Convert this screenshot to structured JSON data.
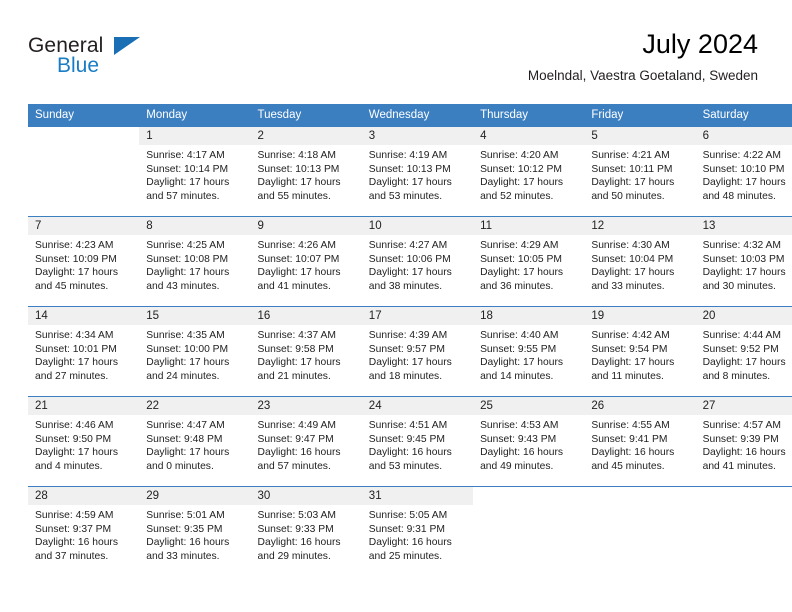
{
  "brand": {
    "name_part1": "General",
    "name_part2": "Blue",
    "triangle_color": "#1a6fb4",
    "blue_color": "#1a7dc4"
  },
  "header": {
    "title": "July 2024",
    "subtitle": "Moelndal, Vaestra Goetaland, Sweden"
  },
  "theme": {
    "header_bg": "#3c7fc1",
    "daynum_bg": "#f0f0f0",
    "text": "#222222"
  },
  "calendar": {
    "weekday_headers": [
      "Sunday",
      "Monday",
      "Tuesday",
      "Wednesday",
      "Thursday",
      "Friday",
      "Saturday"
    ],
    "weeks": [
      [
        {
          "day": "",
          "sunrise": "",
          "sunset": "",
          "daylight_line1": "",
          "daylight_line2": ""
        },
        {
          "day": "1",
          "sunrise": "Sunrise: 4:17 AM",
          "sunset": "Sunset: 10:14 PM",
          "daylight_line1": "Daylight: 17 hours",
          "daylight_line2": "and 57 minutes."
        },
        {
          "day": "2",
          "sunrise": "Sunrise: 4:18 AM",
          "sunset": "Sunset: 10:13 PM",
          "daylight_line1": "Daylight: 17 hours",
          "daylight_line2": "and 55 minutes."
        },
        {
          "day": "3",
          "sunrise": "Sunrise: 4:19 AM",
          "sunset": "Sunset: 10:13 PM",
          "daylight_line1": "Daylight: 17 hours",
          "daylight_line2": "and 53 minutes."
        },
        {
          "day": "4",
          "sunrise": "Sunrise: 4:20 AM",
          "sunset": "Sunset: 10:12 PM",
          "daylight_line1": "Daylight: 17 hours",
          "daylight_line2": "and 52 minutes."
        },
        {
          "day": "5",
          "sunrise": "Sunrise: 4:21 AM",
          "sunset": "Sunset: 10:11 PM",
          "daylight_line1": "Daylight: 17 hours",
          "daylight_line2": "and 50 minutes."
        },
        {
          "day": "6",
          "sunrise": "Sunrise: 4:22 AM",
          "sunset": "Sunset: 10:10 PM",
          "daylight_line1": "Daylight: 17 hours",
          "daylight_line2": "and 48 minutes."
        }
      ],
      [
        {
          "day": "7",
          "sunrise": "Sunrise: 4:23 AM",
          "sunset": "Sunset: 10:09 PM",
          "daylight_line1": "Daylight: 17 hours",
          "daylight_line2": "and 45 minutes."
        },
        {
          "day": "8",
          "sunrise": "Sunrise: 4:25 AM",
          "sunset": "Sunset: 10:08 PM",
          "daylight_line1": "Daylight: 17 hours",
          "daylight_line2": "and 43 minutes."
        },
        {
          "day": "9",
          "sunrise": "Sunrise: 4:26 AM",
          "sunset": "Sunset: 10:07 PM",
          "daylight_line1": "Daylight: 17 hours",
          "daylight_line2": "and 41 minutes."
        },
        {
          "day": "10",
          "sunrise": "Sunrise: 4:27 AM",
          "sunset": "Sunset: 10:06 PM",
          "daylight_line1": "Daylight: 17 hours",
          "daylight_line2": "and 38 minutes."
        },
        {
          "day": "11",
          "sunrise": "Sunrise: 4:29 AM",
          "sunset": "Sunset: 10:05 PM",
          "daylight_line1": "Daylight: 17 hours",
          "daylight_line2": "and 36 minutes."
        },
        {
          "day": "12",
          "sunrise": "Sunrise: 4:30 AM",
          "sunset": "Sunset: 10:04 PM",
          "daylight_line1": "Daylight: 17 hours",
          "daylight_line2": "and 33 minutes."
        },
        {
          "day": "13",
          "sunrise": "Sunrise: 4:32 AM",
          "sunset": "Sunset: 10:03 PM",
          "daylight_line1": "Daylight: 17 hours",
          "daylight_line2": "and 30 minutes."
        }
      ],
      [
        {
          "day": "14",
          "sunrise": "Sunrise: 4:34 AM",
          "sunset": "Sunset: 10:01 PM",
          "daylight_line1": "Daylight: 17 hours",
          "daylight_line2": "and 27 minutes."
        },
        {
          "day": "15",
          "sunrise": "Sunrise: 4:35 AM",
          "sunset": "Sunset: 10:00 PM",
          "daylight_line1": "Daylight: 17 hours",
          "daylight_line2": "and 24 minutes."
        },
        {
          "day": "16",
          "sunrise": "Sunrise: 4:37 AM",
          "sunset": "Sunset: 9:58 PM",
          "daylight_line1": "Daylight: 17 hours",
          "daylight_line2": "and 21 minutes."
        },
        {
          "day": "17",
          "sunrise": "Sunrise: 4:39 AM",
          "sunset": "Sunset: 9:57 PM",
          "daylight_line1": "Daylight: 17 hours",
          "daylight_line2": "and 18 minutes."
        },
        {
          "day": "18",
          "sunrise": "Sunrise: 4:40 AM",
          "sunset": "Sunset: 9:55 PM",
          "daylight_line1": "Daylight: 17 hours",
          "daylight_line2": "and 14 minutes."
        },
        {
          "day": "19",
          "sunrise": "Sunrise: 4:42 AM",
          "sunset": "Sunset: 9:54 PM",
          "daylight_line1": "Daylight: 17 hours",
          "daylight_line2": "and 11 minutes."
        },
        {
          "day": "20",
          "sunrise": "Sunrise: 4:44 AM",
          "sunset": "Sunset: 9:52 PM",
          "daylight_line1": "Daylight: 17 hours",
          "daylight_line2": "and 8 minutes."
        }
      ],
      [
        {
          "day": "21",
          "sunrise": "Sunrise: 4:46 AM",
          "sunset": "Sunset: 9:50 PM",
          "daylight_line1": "Daylight: 17 hours",
          "daylight_line2": "and 4 minutes."
        },
        {
          "day": "22",
          "sunrise": "Sunrise: 4:47 AM",
          "sunset": "Sunset: 9:48 PM",
          "daylight_line1": "Daylight: 17 hours",
          "daylight_line2": "and 0 minutes."
        },
        {
          "day": "23",
          "sunrise": "Sunrise: 4:49 AM",
          "sunset": "Sunset: 9:47 PM",
          "daylight_line1": "Daylight: 16 hours",
          "daylight_line2": "and 57 minutes."
        },
        {
          "day": "24",
          "sunrise": "Sunrise: 4:51 AM",
          "sunset": "Sunset: 9:45 PM",
          "daylight_line1": "Daylight: 16 hours",
          "daylight_line2": "and 53 minutes."
        },
        {
          "day": "25",
          "sunrise": "Sunrise: 4:53 AM",
          "sunset": "Sunset: 9:43 PM",
          "daylight_line1": "Daylight: 16 hours",
          "daylight_line2": "and 49 minutes."
        },
        {
          "day": "26",
          "sunrise": "Sunrise: 4:55 AM",
          "sunset": "Sunset: 9:41 PM",
          "daylight_line1": "Daylight: 16 hours",
          "daylight_line2": "and 45 minutes."
        },
        {
          "day": "27",
          "sunrise": "Sunrise: 4:57 AM",
          "sunset": "Sunset: 9:39 PM",
          "daylight_line1": "Daylight: 16 hours",
          "daylight_line2": "and 41 minutes."
        }
      ],
      [
        {
          "day": "28",
          "sunrise": "Sunrise: 4:59 AM",
          "sunset": "Sunset: 9:37 PM",
          "daylight_line1": "Daylight: 16 hours",
          "daylight_line2": "and 37 minutes."
        },
        {
          "day": "29",
          "sunrise": "Sunrise: 5:01 AM",
          "sunset": "Sunset: 9:35 PM",
          "daylight_line1": "Daylight: 16 hours",
          "daylight_line2": "and 33 minutes."
        },
        {
          "day": "30",
          "sunrise": "Sunrise: 5:03 AM",
          "sunset": "Sunset: 9:33 PM",
          "daylight_line1": "Daylight: 16 hours",
          "daylight_line2": "and 29 minutes."
        },
        {
          "day": "31",
          "sunrise": "Sunrise: 5:05 AM",
          "sunset": "Sunset: 9:31 PM",
          "daylight_line1": "Daylight: 16 hours",
          "daylight_line2": "and 25 minutes."
        },
        {
          "day": "",
          "sunrise": "",
          "sunset": "",
          "daylight_line1": "",
          "daylight_line2": ""
        },
        {
          "day": "",
          "sunrise": "",
          "sunset": "",
          "daylight_line1": "",
          "daylight_line2": ""
        },
        {
          "day": "",
          "sunrise": "",
          "sunset": "",
          "daylight_line1": "",
          "daylight_line2": ""
        }
      ]
    ]
  }
}
